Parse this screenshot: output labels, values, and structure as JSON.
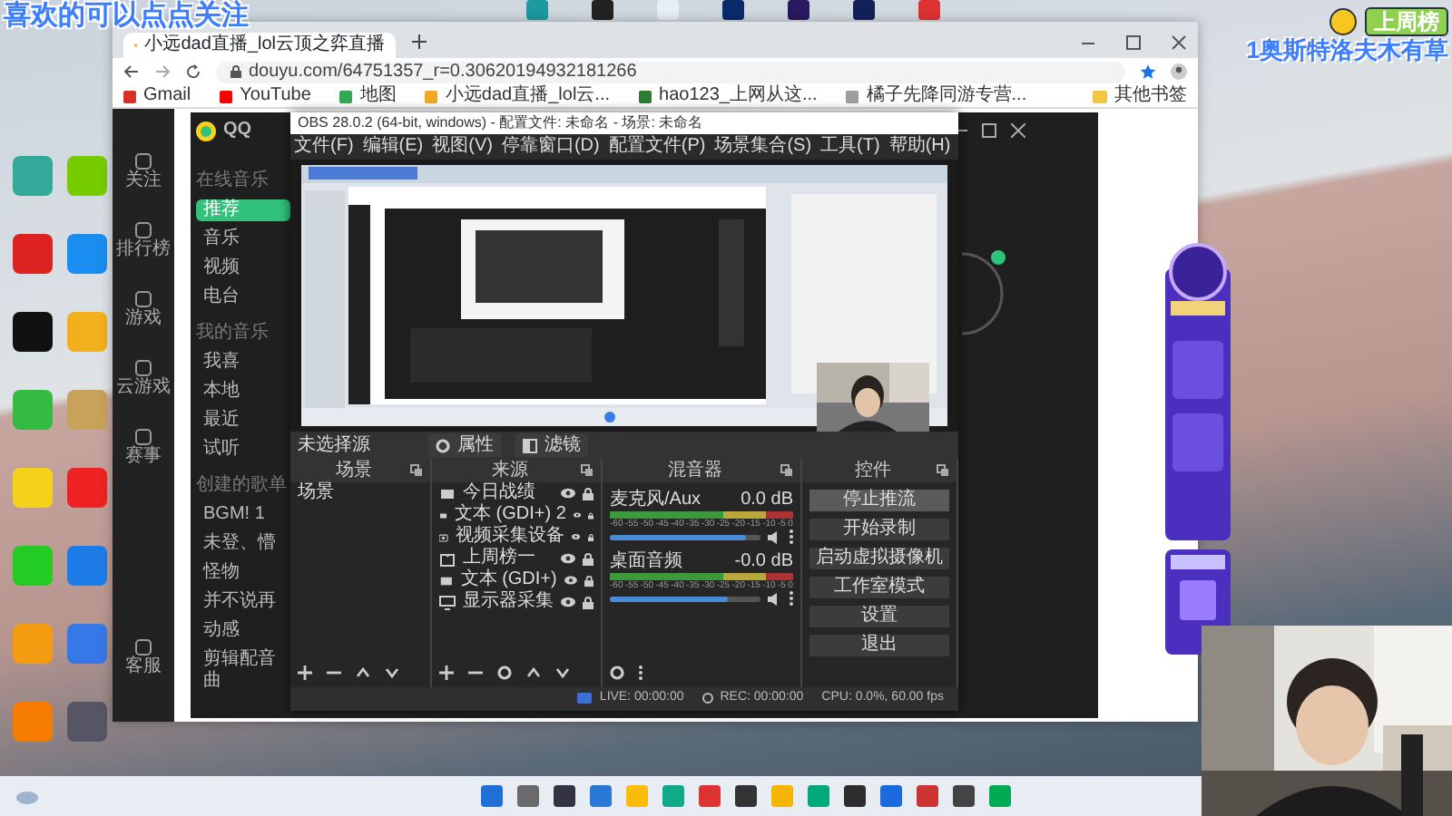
{
  "overlay": {
    "caption": "喜欢的可以点点关注",
    "rank_title": "上周榜",
    "rank_name": "1奥斯特洛夫木有草"
  },
  "browser": {
    "tab_title": "小远dad直播_lol云顶之弈直播",
    "url": "douyu.com/64751357_r=0.30620194932181266",
    "bookmarks": [
      {
        "label": "Gmail",
        "color": "#d93025"
      },
      {
        "label": "YouTube",
        "color": "#ff0000"
      },
      {
        "label": "地图",
        "color": "#34a853"
      },
      {
        "label": "小远dad直播_lol云...",
        "color": "#f5a623"
      },
      {
        "label": "hao123_上网从这...",
        "color": "#2e7d32"
      },
      {
        "label": "橘子先降同游专营...",
        "color": "#9e9e9e"
      }
    ],
    "other_bookmarks": "其他书签",
    "side_nav": [
      "关注",
      "排行榜",
      "游戏",
      "云游戏",
      "赛事",
      "客服"
    ]
  },
  "music_app": {
    "brand": "QQ",
    "menu": [
      {
        "kind": "heading",
        "label": "在线音乐"
      },
      {
        "kind": "item",
        "label": "推荐",
        "selected": true
      },
      {
        "kind": "item",
        "label": "音乐",
        "selected": false
      },
      {
        "kind": "item",
        "label": "视频",
        "selected": false
      },
      {
        "kind": "item",
        "label": "电台",
        "selected": false
      },
      {
        "kind": "heading",
        "label": "我的音乐"
      },
      {
        "kind": "item",
        "label": "我喜",
        "selected": false
      },
      {
        "kind": "item",
        "label": "本地",
        "selected": false
      },
      {
        "kind": "item",
        "label": "最近",
        "selected": false
      },
      {
        "kind": "item",
        "label": "试听",
        "selected": false
      },
      {
        "kind": "heading",
        "label": "创建的歌单"
      },
      {
        "kind": "item",
        "label": "BGM! 1",
        "selected": false
      },
      {
        "kind": "item",
        "label": "未登、懵",
        "selected": false
      },
      {
        "kind": "item",
        "label": "怪物",
        "selected": false
      },
      {
        "kind": "item",
        "label": "并不说再",
        "selected": false
      },
      {
        "kind": "item",
        "label": "动感",
        "selected": false
      },
      {
        "kind": "item",
        "label": "剪辑配音曲",
        "selected": false
      }
    ]
  },
  "obs": {
    "title": "OBS 28.0.2 (64-bit, windows) - 配置文件: 未命名 - 场景: 未命名",
    "menu": [
      "文件(F)",
      "编辑(E)",
      "视图(V)",
      "停靠窗口(D)",
      "配置文件(P)",
      "场景集合(S)",
      "工具(T)",
      "帮助(H)"
    ],
    "source_bar": {
      "label": "未选择源",
      "buttons": [
        "属性",
        "滤镜"
      ]
    },
    "scenes": {
      "title": "场景",
      "items": [
        {
          "label": "场景",
          "selected": false
        }
      ]
    },
    "sources": {
      "title": "来源",
      "items": [
        {
          "label": "今日战绩",
          "kind": "text"
        },
        {
          "label": "文本 (GDI+) 2",
          "kind": "text"
        },
        {
          "label": "视频采集设备",
          "kind": "camera"
        },
        {
          "label": "上周榜一",
          "kind": "group"
        },
        {
          "label": "文本 (GDI+)",
          "kind": "text"
        },
        {
          "label": "显示器采集",
          "kind": "monitor"
        }
      ]
    },
    "mixer": {
      "title": "混音器",
      "channels": [
        {
          "name": "麦克风/Aux",
          "reading": "0.0 dB",
          "level": 0.9,
          "scale": [
            "-60",
            "-55",
            "-50",
            "-45",
            "-40",
            "-35",
            "-30",
            "-25",
            "-20",
            "-15",
            "-10",
            "-5",
            "0"
          ]
        },
        {
          "name": "桌面音频",
          "reading": "-0.0 dB",
          "level": 0.78,
          "scale": [
            "-60",
            "-55",
            "-50",
            "-45",
            "-40",
            "-35",
            "-30",
            "-25",
            "-20",
            "-15",
            "-10",
            "-5",
            "0"
          ]
        }
      ]
    },
    "controls": {
      "title": "控件",
      "buttons": [
        {
          "label": "停止推流",
          "hovered": true
        },
        {
          "label": "开始录制",
          "hovered": false
        },
        {
          "label": "启动虚拟摄像机",
          "hovered": false
        },
        {
          "label": "工作室模式",
          "hovered": false
        },
        {
          "label": "设置",
          "hovered": false
        },
        {
          "label": "退出",
          "hovered": false
        }
      ]
    },
    "status": {
      "live": "LIVE: 00:00:00",
      "rec": "REC: 00:00:00",
      "cpu": "CPU: 0.0%, 60.00 fps"
    }
  }
}
